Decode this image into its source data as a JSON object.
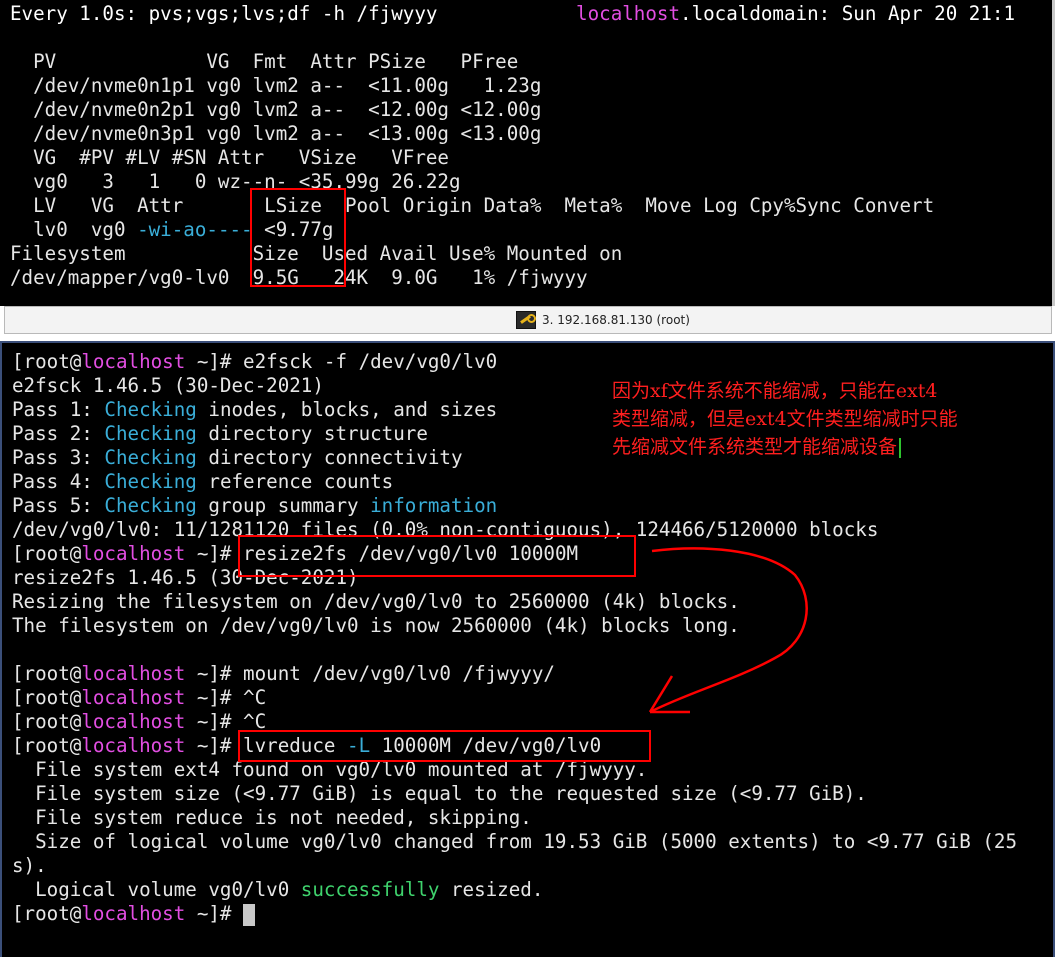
{
  "top_terminal": {
    "header_left": "Every 1.0s: pvs;vgs;lvs;df -h /fjwyyy",
    "header_host": "localhost",
    "header_right": ".localdomain: Sun Apr 20 21:1",
    "lines": [
      "  PV             VG  Fmt  Attr PSize   PFree",
      "  /dev/nvme0n1p1 vg0 lvm2 a--  <11.00g   1.23g",
      "  /dev/nvme0n2p1 vg0 lvm2 a--  <12.00g <12.00g",
      "  /dev/nvme0n3p1 vg0 lvm2 a--  <13.00g <13.00g",
      "  VG  #PV #LV #SN Attr   VSize   VFree",
      "  vg0   3   1   0 wz--n- <35.99g 26.22g",
      "  LV   VG  Attr       LSize  Pool Origin Data%  Meta%  Move Log Cpy%Sync Convert"
    ],
    "lv_row": {
      "prefix": "  lv0  vg0 ",
      "attr": "-wi-ao----",
      "size": " <9.77g"
    },
    "df_header": "Filesystem           Size  Used Avail Use% Mounted on",
    "df_row": "/dev/mapper/vg0-lv0  9.5G   24K  9.0G   1% /fjwyyy"
  },
  "tab": {
    "label": "3. 192.168.81.130 (root)",
    "icon": "key-icon"
  },
  "bottom_terminal": {
    "prompt_open": "[root@",
    "prompt_host": "localhost",
    "prompt_close": " ~]# ",
    "cmd1": "e2fsck -f /dev/vg0/lv0",
    "e2fsck_version": "e2fsck 1.46.5 (30-Dec-2021)",
    "passes": [
      {
        "prefix": "Pass 1: ",
        "checking": "Checking",
        "rest": " inodes, blocks, and sizes"
      },
      {
        "prefix": "Pass 2: ",
        "checking": "Checking",
        "rest": " directory structure"
      },
      {
        "prefix": "Pass 3: ",
        "checking": "Checking",
        "rest": " directory connectivity"
      },
      {
        "prefix": "Pass 4: ",
        "checking": "Checking",
        "rest": " reference counts"
      },
      {
        "prefix": "Pass 5: ",
        "checking": "Checking",
        "rest": " group summary ",
        "extra": "information"
      }
    ],
    "fs_summary": "/dev/vg0/lv0: 11/1281120 files (0.0% non-contiguous), 124466/5120000 blocks",
    "cmd2": "resize2fs /dev/vg0/lv0 10000M",
    "resize_version": "resize2fs 1.46.5 (30-Dec-2021)",
    "resize_out1": "Resizing the filesystem on /dev/vg0/lv0 to 2560000 (4k) blocks.",
    "resize_out2": "The filesystem on /dev/vg0/lv0 is now 2560000 (4k) blocks long.",
    "cmd3": "mount /dev/vg0/lv0 /fjwyyy/",
    "cmd4": "^C",
    "cmd5": "^C",
    "cmd6_pre": "lvreduce ",
    "cmd6_flag": "-L",
    "cmd6_post": " 10000M /dev/vg0/lv0",
    "lvr_out1": "  File system ext4 found on vg0/lv0 mounted at /fjwyyy.",
    "lvr_out2": "  File system size (<9.77 GiB) is equal to the requested size (<9.77 GiB).",
    "lvr_out3": "  File system reduce is not needed, skipping.",
    "lvr_out4": "  Size of logical volume vg0/lv0 changed from 19.53 GiB (5000 extents) to <9.77 GiB (25",
    "lvr_out5": "s).",
    "lvr_out6_pre": "  Logical volume vg0/lv0 ",
    "lvr_out6_ok": "successfully",
    "lvr_out6_post": " resized."
  },
  "annotation": {
    "line1": "因为xf文件系统不能缩减，只能在ext4",
    "line2": "类型缩减，但是ext4文件类型缩减时只能",
    "line3": "先缩减文件系统类型才能缩减设备"
  },
  "colors": {
    "highlight": "#ff0000",
    "host": "#e24ee2",
    "keyword": "#3aaed8",
    "success": "#3fd36d"
  }
}
